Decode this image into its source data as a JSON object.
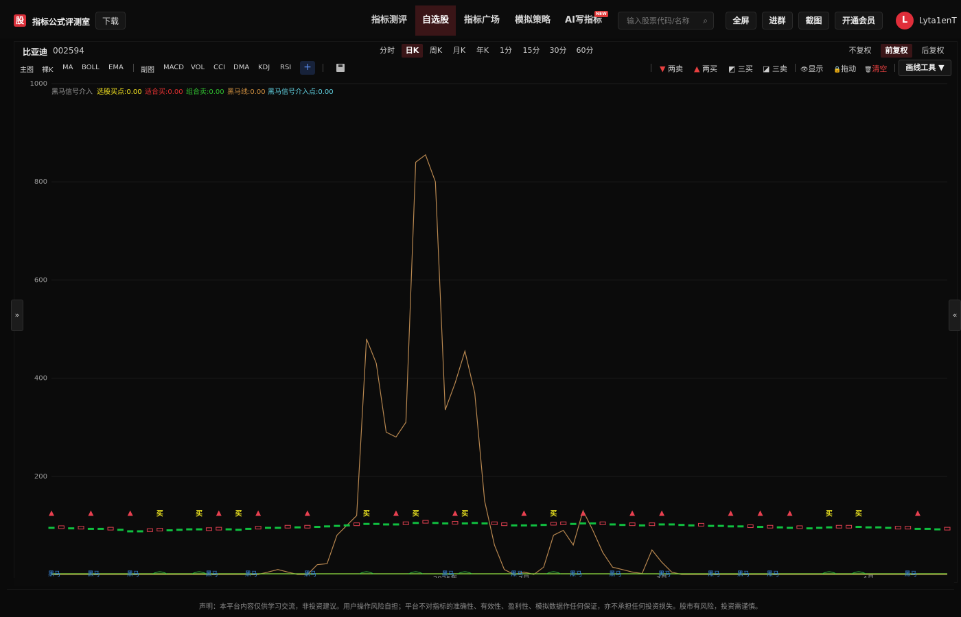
{
  "header": {
    "logo_text": "股",
    "app_title": "指标公式评测室",
    "download_label": "下载",
    "nav": [
      {
        "label": "指标测评",
        "active": false
      },
      {
        "label": "自选股",
        "active": true
      },
      {
        "label": "指标广场",
        "active": false
      },
      {
        "label": "模拟策略",
        "active": false
      },
      {
        "label": "AI写指标",
        "active": false
      }
    ],
    "new_badge": "NEW",
    "search_placeholder": "输入股票代码/名称",
    "buttons": [
      "全屏",
      "进群",
      "截图",
      "开通会员"
    ],
    "avatar_letter": "L",
    "username": "Lyta1enT"
  },
  "stock": {
    "name": "比亚迪",
    "code": "002594"
  },
  "periods": [
    "分时",
    "日K",
    "周K",
    "月K",
    "年K",
    "1分",
    "15分",
    "30分",
    "60分"
  ],
  "active_period": "日K",
  "adjust": [
    "不复权",
    "前复权",
    "后复权"
  ],
  "active_adjust": "前复权",
  "indicators_main": [
    "主图",
    "裸K",
    "MA",
    "BOLL",
    "EMA"
  ],
  "indicators_sub": [
    "副图",
    "MACD",
    "VOL",
    "CCI",
    "DMA",
    "KDJ",
    "RSI"
  ],
  "plus_label": "+",
  "tools": [
    {
      "label": "两卖",
      "icon": "▼",
      "color": "#e84040"
    },
    {
      "label": "两买",
      "icon": "▲",
      "color": "#e84040"
    },
    {
      "label": "三买",
      "icon": "◩",
      "color": "#d0d0d0"
    },
    {
      "label": "三卖",
      "icon": "◪",
      "color": "#d0d0d0"
    },
    {
      "label": "显示",
      "icon": "👁",
      "color": "#d0d0d0"
    },
    {
      "label": "拖动",
      "icon": "🔒",
      "color": "#e8c840"
    },
    {
      "label": "清空",
      "icon": "🗑",
      "color": "#e84040"
    }
  ],
  "draw_tools_label": "画线工具 ▼",
  "legend": [
    {
      "text": "黑马信号介入",
      "color": "#9a9a9a"
    },
    {
      "text": "选股买点:0.00",
      "color": "#f0e020"
    },
    {
      "text": "适合买:0.00",
      "color": "#e03030"
    },
    {
      "text": "组合卖:0.00",
      "color": "#30c030"
    },
    {
      "text": "黑马线:0.00",
      "color": "#d09040"
    },
    {
      "text": "黑马信号介入点:0.00",
      "color": "#60d0e0"
    }
  ],
  "side_left": "»",
  "side_right": "«",
  "disclaimer": "声明：本平台内容仅供学习交流，非投资建议。用户操作风险自担；平台不对指标的准确性、有效性、盈利性、模拟数据作任何保证，亦不承担任何投资损失。股市有风险，投资需谨慎。",
  "chart_data": {
    "type": "line",
    "ylim": [
      0,
      1000
    ],
    "yticks": [
      1000,
      800,
      600,
      400,
      200
    ],
    "x_labels": [
      "2026年",
      "2月",
      "3月",
      "4月"
    ],
    "marker_labels": {
      "buy": "买",
      "dark_horse": "黑马"
    },
    "series": [
      {
        "name": "黑马线",
        "values": [
          0,
          0,
          0,
          0,
          0,
          0,
          0,
          0,
          0,
          0,
          0,
          0,
          0,
          0,
          0,
          0,
          0,
          0,
          0,
          0,
          0,
          0,
          5,
          10,
          5,
          0,
          0,
          20,
          22,
          80,
          100,
          120,
          480,
          430,
          290,
          280,
          310,
          840,
          855,
          800,
          335,
          390,
          455,
          370,
          150,
          60,
          10,
          0,
          5,
          0,
          15,
          80,
          90,
          60,
          130,
          90,
          45,
          15,
          10,
          5,
          2,
          50,
          25,
          5,
          0,
          0,
          0,
          0,
          0,
          0,
          0,
          0,
          0,
          0,
          0,
          0,
          0,
          0,
          0,
          0,
          0,
          0,
          0,
          0,
          0,
          0,
          0,
          0,
          0,
          0,
          0,
          0
        ]
      },
      {
        "name": "K线",
        "values": [
          95,
          95,
          94,
          94,
          93,
          93,
          92,
          91,
          88,
          88,
          89,
          90,
          90,
          91,
          92,
          92,
          91,
          92,
          92,
          91,
          93,
          94,
          95,
          95,
          96,
          96,
          96,
          97,
          98,
          99,
          100,
          101,
          103,
          103,
          102,
          102,
          103,
          105,
          106,
          105,
          104,
          104,
          104,
          105,
          104,
          103,
          101,
          100,
          100,
          100,
          101,
          102,
          103,
          103,
          104,
          104,
          103,
          102,
          101,
          101,
          100,
          101,
          102,
          102,
          101,
          100,
          100,
          99,
          99,
          98,
          98,
          97,
          97,
          96,
          96,
          95,
          95,
          94,
          95,
          96,
          96,
          96,
          97,
          96,
          96,
          95,
          94,
          94,
          93,
          93,
          92,
          92
        ]
      }
    ]
  }
}
